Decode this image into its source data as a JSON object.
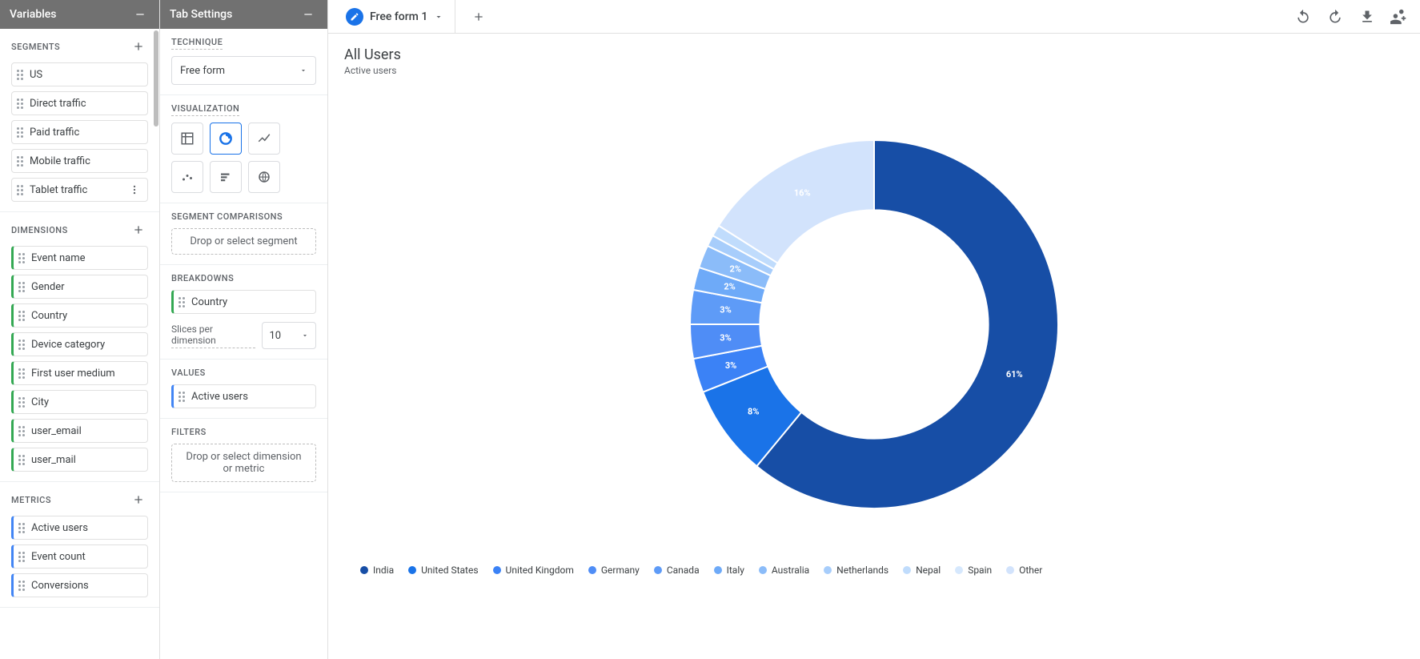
{
  "variables_panel": {
    "title": "Variables",
    "segments": {
      "heading": "SEGMENTS",
      "items": [
        "US",
        "Direct traffic",
        "Paid traffic",
        "Mobile traffic",
        "Tablet traffic"
      ]
    },
    "dimensions": {
      "heading": "DIMENSIONS",
      "items": [
        "Event name",
        "Gender",
        "Country",
        "Device category",
        "First user medium",
        "City",
        "user_email",
        "user_mail"
      ]
    },
    "metrics": {
      "heading": "METRICS",
      "items": [
        "Active users",
        "Event count",
        "Conversions"
      ]
    }
  },
  "tab_settings_panel": {
    "title": "Tab Settings",
    "technique": {
      "heading": "TECHNIQUE",
      "value": "Free form"
    },
    "visualization": {
      "heading": "VISUALIZATION",
      "options": [
        "table",
        "donut",
        "line",
        "scatter",
        "bar",
        "geo"
      ],
      "active": "donut"
    },
    "segment_comparisons": {
      "heading": "SEGMENT COMPARISONS",
      "placeholder": "Drop or select segment"
    },
    "breakdowns": {
      "heading": "BREAKDOWNS",
      "items": [
        "Country"
      ],
      "slices_label": "Slices per dimension",
      "slices_value": "10"
    },
    "values": {
      "heading": "VALUES",
      "items": [
        "Active users"
      ]
    },
    "filters": {
      "heading": "FILTERS",
      "placeholder": "Drop or select dimension or metric"
    }
  },
  "tabs": {
    "active_tab": "Free form 1"
  },
  "chart": {
    "title": "All Users",
    "subtitle": "Active users"
  },
  "chart_data": {
    "type": "pie",
    "title": "All Users — Active users by Country",
    "series": [
      {
        "name": "India",
        "value": 61,
        "color": "#174ea6",
        "label": "61%"
      },
      {
        "name": "United States",
        "value": 8,
        "color": "#1a73e8",
        "label": "8%"
      },
      {
        "name": "United Kingdom",
        "value": 3,
        "color": "#3b82f6",
        "label": "3%"
      },
      {
        "name": "Germany",
        "value": 3,
        "color": "#4f8df6",
        "label": "3%"
      },
      {
        "name": "Canada",
        "value": 3,
        "color": "#5e9bf7",
        "label": "3%"
      },
      {
        "name": "Italy",
        "value": 2,
        "color": "#6eaaf8",
        "label": "2%"
      },
      {
        "name": "Australia",
        "value": 2,
        "color": "#8bbcf9",
        "label": "2%"
      },
      {
        "name": "Netherlands",
        "value": 1,
        "color": "#a7cdfb",
        "label": ""
      },
      {
        "name": "Nepal",
        "value": 1,
        "color": "#c0dcfc",
        "label": ""
      },
      {
        "name": "Spain",
        "value": 0,
        "color": "#d6e8fd",
        "label": ""
      },
      {
        "name": "Other",
        "value": 16,
        "color": "#d2e3fc",
        "label": "16%"
      }
    ],
    "inner_radius_ratio": 0.62
  }
}
